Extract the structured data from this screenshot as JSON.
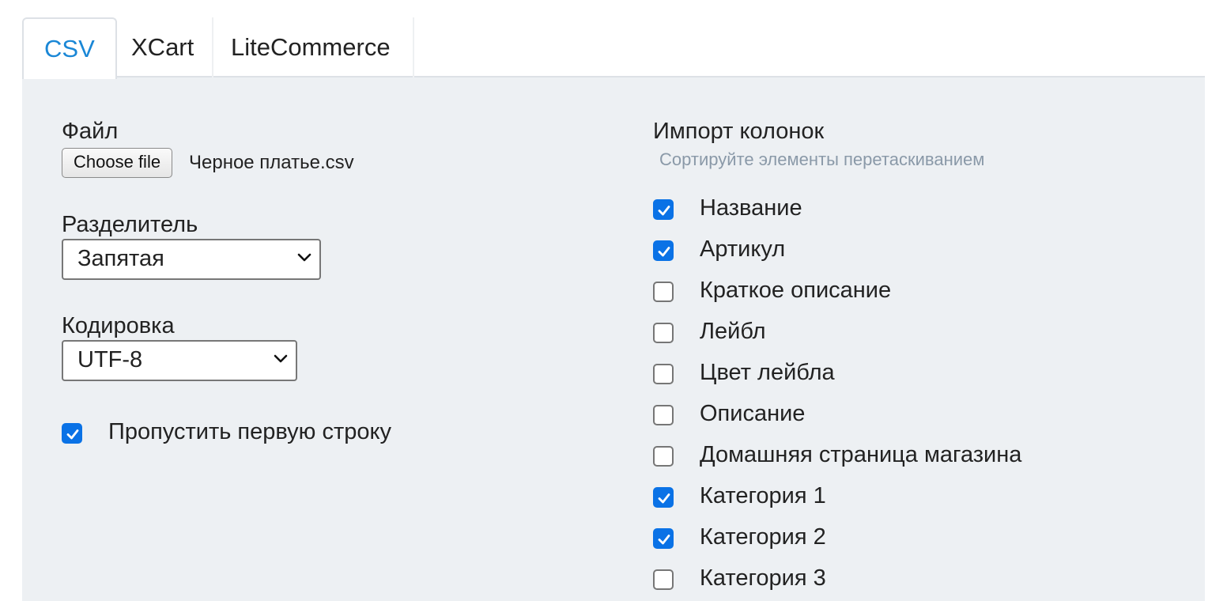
{
  "tabs": [
    {
      "label": "CSV",
      "active": true
    },
    {
      "label": "XCart",
      "active": false
    },
    {
      "label": "LiteCommerce",
      "active": false
    }
  ],
  "left": {
    "file_label": "Файл",
    "file_button": "Choose file",
    "file_name": "Черное платье.csv",
    "separator_label": "Разделитель",
    "separator_value": "Запятая",
    "encoding_label": "Кодировка",
    "encoding_value": "UTF-8",
    "skip_first_row_label": "Пропустить первую строку",
    "skip_first_row_checked": true
  },
  "right": {
    "title": "Импорт колонок",
    "hint": "Сортируйте элементы перетаскиванием",
    "columns": [
      {
        "label": "Название",
        "checked": true
      },
      {
        "label": "Артикул",
        "checked": true
      },
      {
        "label": "Краткое описание",
        "checked": false
      },
      {
        "label": "Лейбл",
        "checked": false
      },
      {
        "label": "Цвет лейбла",
        "checked": false
      },
      {
        "label": "Описание",
        "checked": false
      },
      {
        "label": "Домашняя страница магазина",
        "checked": false
      },
      {
        "label": "Категория 1",
        "checked": true
      },
      {
        "label": "Категория 2",
        "checked": true
      },
      {
        "label": "Категория 3",
        "checked": false
      }
    ]
  },
  "colors": {
    "accent": "#1a87d6",
    "checkbox_checked": "#0a72e6",
    "panel_background": "#edf0f3",
    "hint_text": "#8a99a8"
  },
  "icons": {
    "checkmark": "check-icon",
    "dropdown": "chevron-down-icon"
  }
}
